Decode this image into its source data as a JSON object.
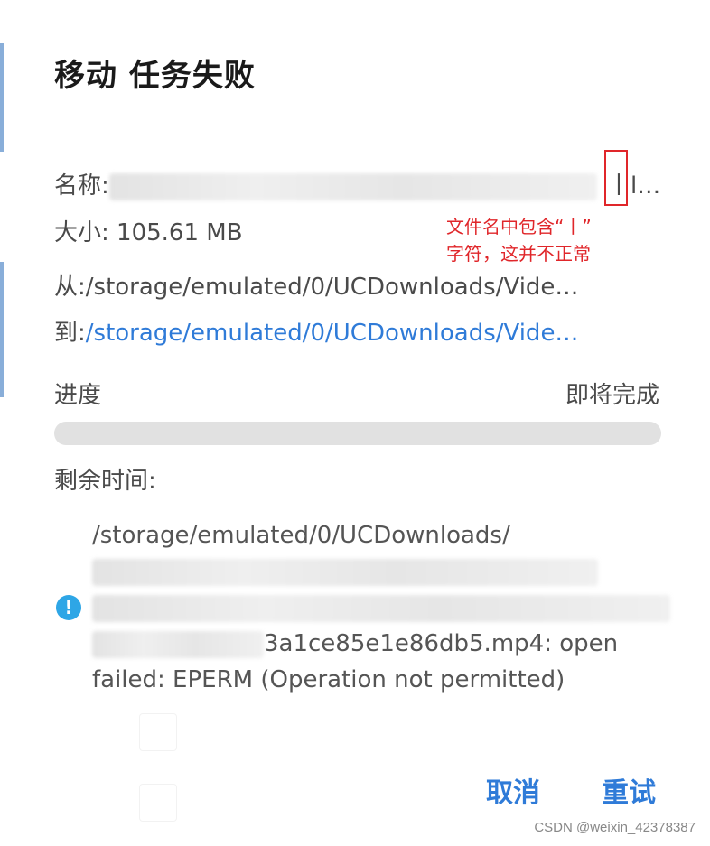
{
  "dialog": {
    "title": "移动 任务失败",
    "name_label": "名称:",
    "name_tail": "丨l…",
    "size_text": "大小: 105.61 MB",
    "from_text": "从:/storage/emulated/0/UCDownloads/Vide…",
    "to_label": "到:",
    "to_path": "/storage/emulated/0/UCDownloads/Vide…",
    "progress_label": "进度",
    "progress_status": "即将完成",
    "progress_fraction": 1.0,
    "remaining_label": "剩余时间:",
    "error_line_1": "/storage/emulated/0/UCDownloads/",
    "error_line_4_tail": "3a1ce85e1e86db5.mp4: open",
    "error_line_5": "failed: EPERM (Operation not permitted)",
    "cancel_label": "取消",
    "retry_label": "重试"
  },
  "annotation": {
    "line1": "文件名中包含“丨”",
    "line2": "字符，这并不正常"
  },
  "watermark": "CSDN @weixin_42378387",
  "colors": {
    "accent": "#2f7bd8",
    "annotation_red": "#e0262a",
    "info_icon": "#2ea6e6"
  }
}
